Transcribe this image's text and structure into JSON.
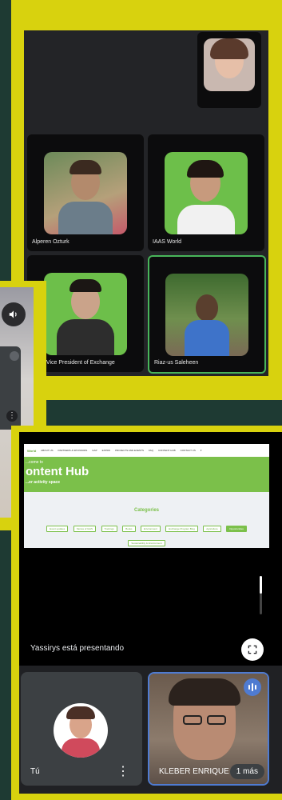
{
  "participants_top": {
    "tile1_name": "Alperen Ozturk",
    "tile2_name": "IAAS World",
    "tile3_name": "IAAS Vice President of Exchange",
    "tile4_name": "Riaz-us Saleheen"
  },
  "shared_page": {
    "nav": [
      "ABOUT US",
      "PARTNERS & SPONSORS",
      "GAP",
      "EXPRO",
      "PROJECTS AND EVENTS",
      "FAQ",
      "CONTENT HUB",
      "CONTACT US"
    ],
    "brand": "World",
    "welcome": "...come to",
    "hero_title": "ontent Hub",
    "hero_sub": "...er activity space",
    "categories_title": "Categories",
    "categories_row1": [
      "Event updates",
      "Stories of IAAS",
      "Trainings",
      "Books",
      "Environment",
      "Exchange Program Blog",
      "Agriculture",
      "Opportunities"
    ],
    "categories_row2": [
      "Sustainability & Environment"
    ]
  },
  "presenting_text": "Yassirys está presentando",
  "bottom_tiles": {
    "self_label": "Tú",
    "other_label": "KLEBER ENRIQUE",
    "more_label": "1 más"
  },
  "colors": {
    "frame_yellow": "#d8d20e",
    "page_bg": "#1e3a33",
    "speaking_green": "#48b55a",
    "hero_green": "#7bc04a"
  }
}
